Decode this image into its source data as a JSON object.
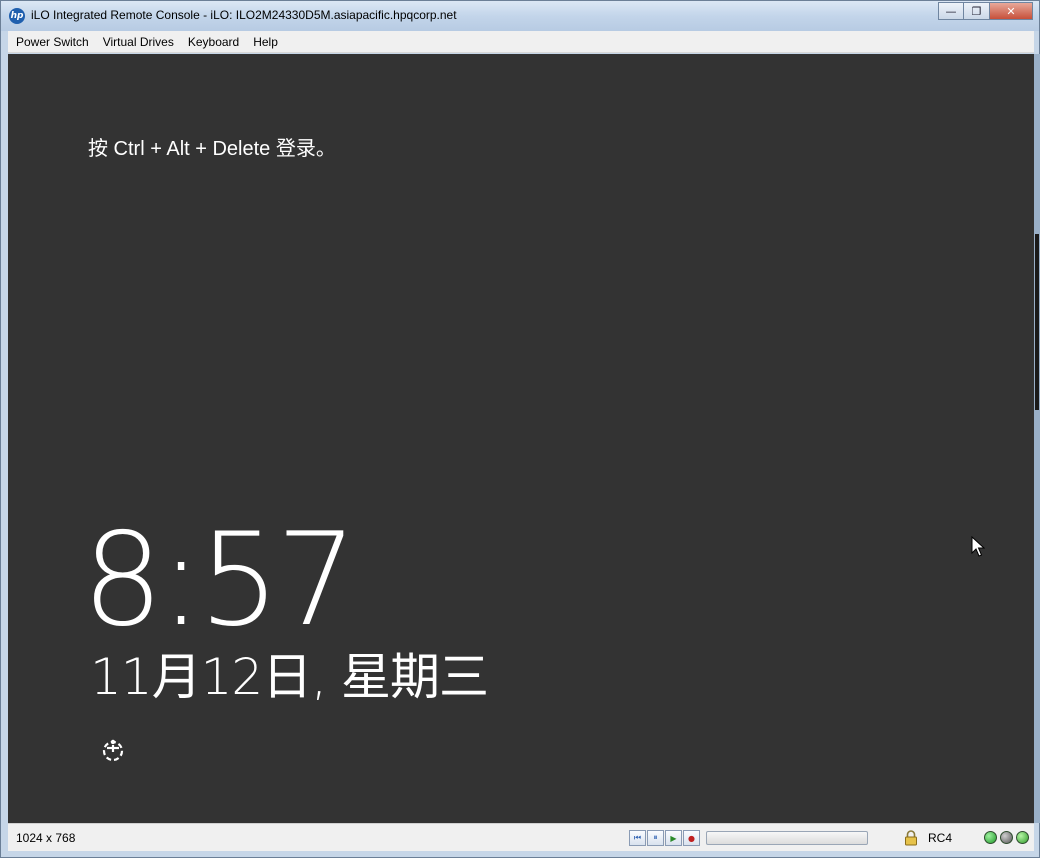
{
  "window": {
    "title": "iLO Integrated Remote Console - iLO: ILO2M24330D5M.asiapacific.hpqcorp.net",
    "logo_text": "hp",
    "controls": {
      "minimize_icon": "minimize-icon",
      "restore_icon": "restore-icon",
      "close_icon": "close-icon",
      "minimize_glyph": "—",
      "restore_glyph": "❐",
      "close_glyph": "✕"
    }
  },
  "menu": {
    "items": [
      {
        "label": "Power Switch"
      },
      {
        "label": "Virtual Drives"
      },
      {
        "label": "Keyboard"
      },
      {
        "label": "Help"
      }
    ]
  },
  "lockscreen": {
    "hint": "按 Ctrl + Alt + Delete 登录。",
    "time": "8:57",
    "date": "11月12日, 星期三",
    "ease_of_access_icon": "ease-of-access-icon"
  },
  "statusbar": {
    "resolution": "1024 x 768",
    "encryption": "RC4",
    "media_buttons": [
      {
        "icon": "rewind-icon",
        "glyph": "⏮"
      },
      {
        "icon": "pause-icon",
        "glyph": "⏸"
      },
      {
        "icon": "play-icon",
        "glyph": "▶"
      },
      {
        "icon": "record-icon",
        "glyph": "●"
      }
    ],
    "lock_icon": "lock-icon",
    "leds": [
      {
        "icon": "status-led-icon",
        "color": "green"
      },
      {
        "icon": "status-led-icon",
        "color": "gray"
      },
      {
        "icon": "status-led-icon",
        "color": "green"
      }
    ]
  },
  "colors": {
    "screen_background": "#333333",
    "title_gradient_top": "#dbe7f5",
    "title_gradient_bottom": "#b7cbe3",
    "close_button": "#c7503a"
  }
}
